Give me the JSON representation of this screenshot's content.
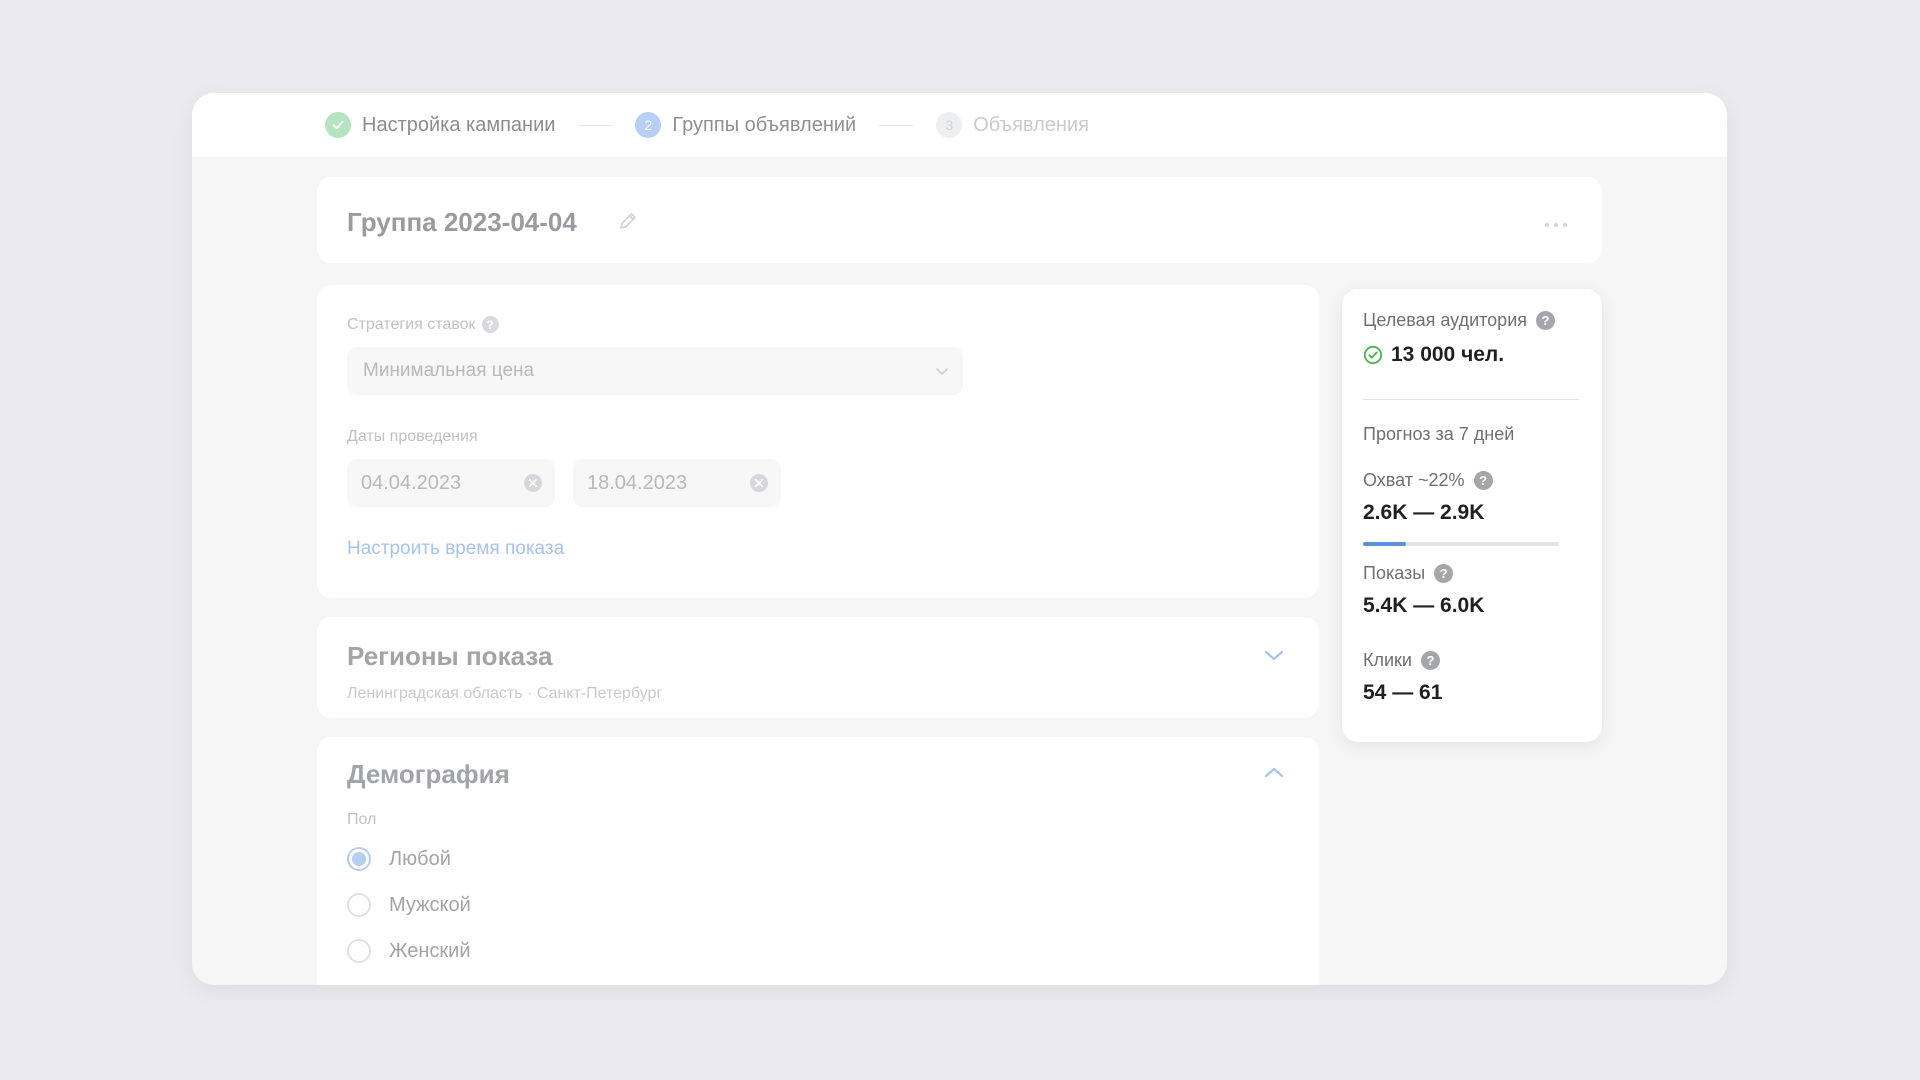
{
  "stepper": {
    "steps": [
      {
        "number": "",
        "label": "Настройка кампании",
        "state": "done"
      },
      {
        "number": "2",
        "label": "Группы объявлений",
        "state": "active"
      },
      {
        "number": "3",
        "label": "Объявления",
        "state": "future"
      }
    ]
  },
  "group": {
    "title": "Группа 2023-04-04"
  },
  "bid_strategy": {
    "label": "Стратегия ставок",
    "help": "?",
    "value": "Минимальная цена"
  },
  "dates": {
    "label": "Даты проведения",
    "start": "04.04.2023",
    "end": "18.04.2023",
    "schedule_link": "Настроить время показа"
  },
  "regions": {
    "title": "Регионы показа",
    "summary": "Ленинградская область · Санкт-Петербург"
  },
  "demography": {
    "title": "Демография",
    "gender_label": "Пол",
    "options": [
      "Любой",
      "Мужской",
      "Женский"
    ],
    "selected_index": 0
  },
  "forecast": {
    "audience_label": "Целевая аудитория",
    "audience_value": "13 000 чел.",
    "period_label": "Прогноз за 7 дней",
    "reach_label": "Охват ~22%",
    "reach_value": "2.6K — 2.9K",
    "reach_fraction": 0.22,
    "impressions_label": "Показы",
    "impressions_value": "5.4K — 6.0K",
    "clicks_label": "Клики",
    "clicks_value": "54 — 61",
    "help": "?"
  },
  "colors": {
    "accent": "#5b8fdb",
    "success": "#4bb34b",
    "background": "#ebebef"
  }
}
